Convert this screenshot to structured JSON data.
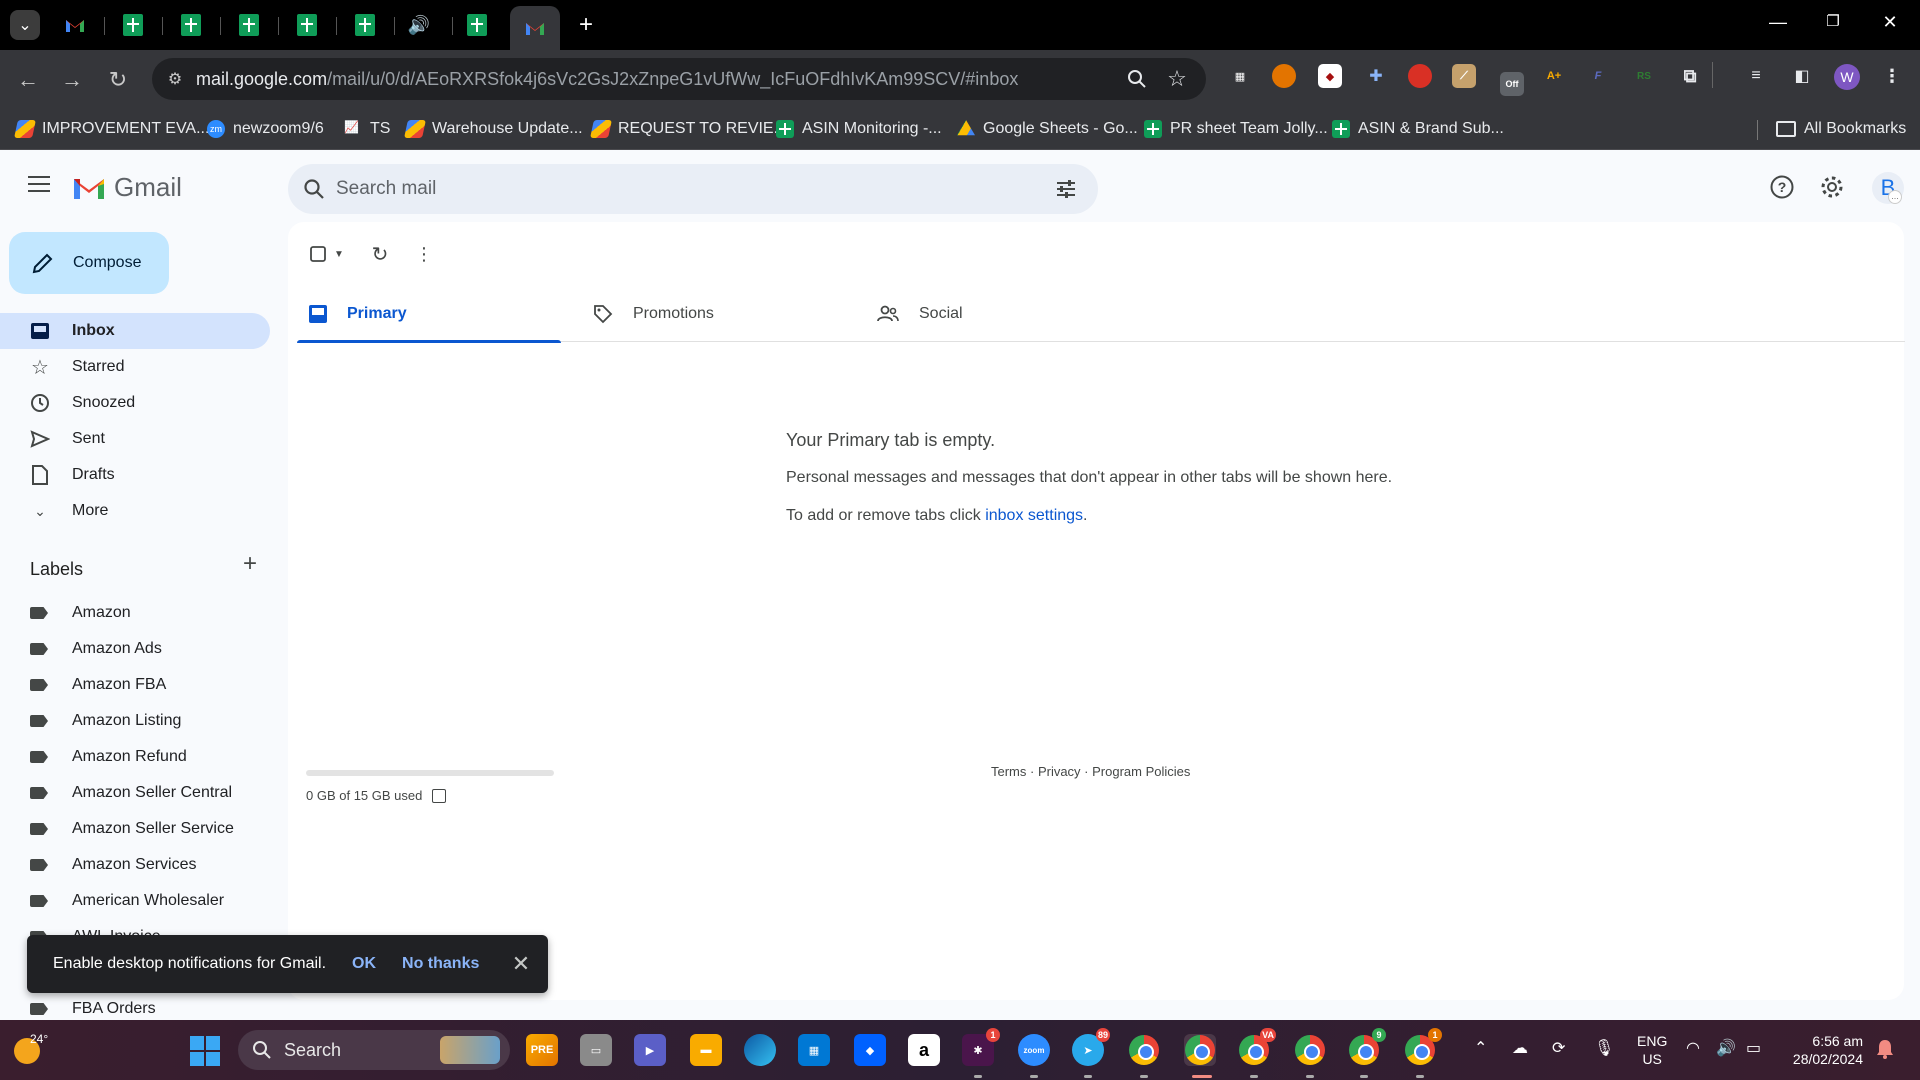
{
  "browser": {
    "url_host": "mail.google.com",
    "url_path": "/mail/u/0/d/AEoRXRSfok4j6sVc2GsJ2xZnpeG1vUfWw_IcFuOFdhIvKAm99SCV/#inbox",
    "profile_initial": "W",
    "extensions": [
      {
        "name": "qr-icon",
        "color": "#5f6368",
        "label": "▦"
      },
      {
        "name": "colorpick-icon",
        "color": "#e37400",
        "label": "◉"
      },
      {
        "name": "ext-red-icon",
        "color": "#a50e0e",
        "label": "◆"
      },
      {
        "name": "puzzle-blue-icon",
        "color": "#1a73e8",
        "label": "✚"
      },
      {
        "name": "pokeball-icon",
        "color": "#d93025",
        "label": "●"
      },
      {
        "name": "chart-ext-icon",
        "color": "#c5a16c",
        "label": "⟋"
      },
      {
        "name": "off-ext-icon",
        "color": "#5f6368",
        "label": "Off"
      },
      {
        "name": "ascout-icon",
        "color": "#f9ab00",
        "label": "A+"
      },
      {
        "name": "f-ext-icon",
        "color": "#3949ab",
        "label": "F"
      },
      {
        "name": "rs-ext-icon",
        "color": "#1e3a1e",
        "label": "RS"
      }
    ]
  },
  "bookmarks": [
    {
      "icon": "multi",
      "label": "IMPROVEMENT EVA..."
    },
    {
      "icon": "zm",
      "label": "newzoom9/6"
    },
    {
      "icon": "chart",
      "label": "TS"
    },
    {
      "icon": "multi",
      "label": "Warehouse Update..."
    },
    {
      "icon": "multi",
      "label": "REQUEST TO REVIE..."
    },
    {
      "icon": "sheets",
      "label": "ASIN Monitoring -..."
    },
    {
      "icon": "drive",
      "label": "Google Sheets - Go..."
    },
    {
      "icon": "sheets",
      "label": "PR sheet Team Jolly..."
    },
    {
      "icon": "sheets",
      "label": "ASIN & Brand Sub..."
    }
  ],
  "bookmarks_folder": "All Bookmarks",
  "gmail": {
    "wordmark": "Gmail",
    "search_placeholder": "Search mail",
    "avatar_initial": "B",
    "compose": "Compose",
    "nav": [
      {
        "key": "inbox",
        "label": "Inbox",
        "active": true
      },
      {
        "key": "starred",
        "label": "Starred"
      },
      {
        "key": "snoozed",
        "label": "Snoozed"
      },
      {
        "key": "sent",
        "label": "Sent"
      },
      {
        "key": "drafts",
        "label": "Drafts"
      },
      {
        "key": "more",
        "label": "More"
      }
    ],
    "labels_heading": "Labels",
    "labels": [
      "Amazon",
      "Amazon Ads",
      "Amazon FBA",
      "Amazon Listing",
      "Amazon Refund",
      "Amazon Seller Central",
      "Amazon Seller Service",
      "Amazon Services",
      "American Wholesaler",
      "AWL Invoice",
      "",
      "FBA Orders"
    ],
    "tabs": [
      {
        "key": "primary",
        "label": "Primary",
        "active": true
      },
      {
        "key": "promotions",
        "label": "Promotions"
      },
      {
        "key": "social",
        "label": "Social"
      }
    ],
    "empty_title": "Your Primary tab is empty.",
    "empty_desc": "Personal messages and messages that don't appear in other tabs will be shown here.",
    "empty_settings_prefix": "To add or remove tabs click ",
    "empty_settings_link": "inbox settings",
    "empty_settings_suffix": ".",
    "storage_text": "0 GB of 15 GB used",
    "storage_fraction": 0.0,
    "footer": "Terms · Privacy · Program Policies"
  },
  "snackbar": {
    "message": "Enable desktop notifications for Gmail.",
    "ok": "OK",
    "no_thanks": "No thanks"
  },
  "taskbar": {
    "temperature": "24°",
    "search_label": "Search",
    "language": "ENG",
    "region": "US",
    "time": "6:56 am",
    "date": "28/02/2024",
    "badges": {
      "slack": "1",
      "telegram": "89",
      "chrome_va": "VA",
      "chrome_9": "9",
      "chrome_1": "1"
    }
  }
}
